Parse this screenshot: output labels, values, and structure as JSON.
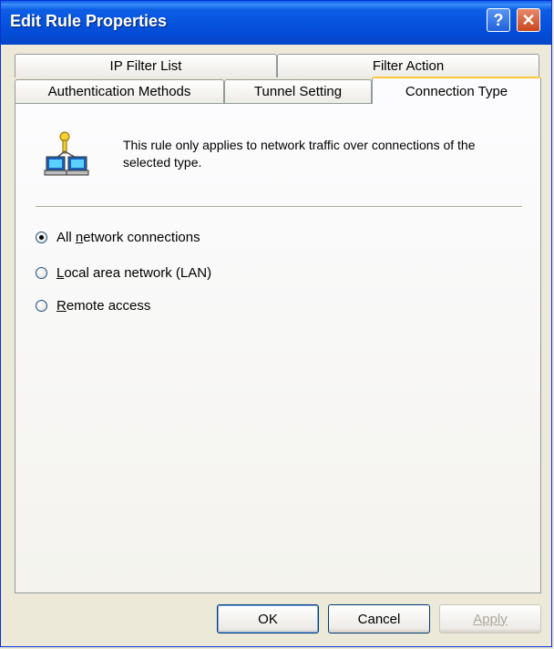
{
  "window": {
    "title": "Edit Rule Properties"
  },
  "titlebar": {
    "help_glyph": "?",
    "close_glyph": "✕"
  },
  "tabs": {
    "row1": [
      {
        "label": "IP Filter List"
      },
      {
        "label": "Filter Action"
      }
    ],
    "row2": [
      {
        "label": "Authentication Methods"
      },
      {
        "label": "Tunnel Setting"
      },
      {
        "label": "Connection Type",
        "active": true
      }
    ]
  },
  "panel": {
    "icon": "network-computers-icon",
    "info_text": "This rule only applies to network traffic over connections of the selected type.",
    "options": [
      {
        "pre": "All ",
        "accel": "n",
        "post": "etwork connections",
        "checked": true
      },
      {
        "pre": "",
        "accel": "L",
        "post": "ocal area network (LAN)",
        "checked": false
      },
      {
        "pre": "",
        "accel": "R",
        "post": "emote access",
        "checked": false
      }
    ]
  },
  "buttons": {
    "ok": "OK",
    "cancel": "Cancel",
    "apply": "Apply"
  }
}
